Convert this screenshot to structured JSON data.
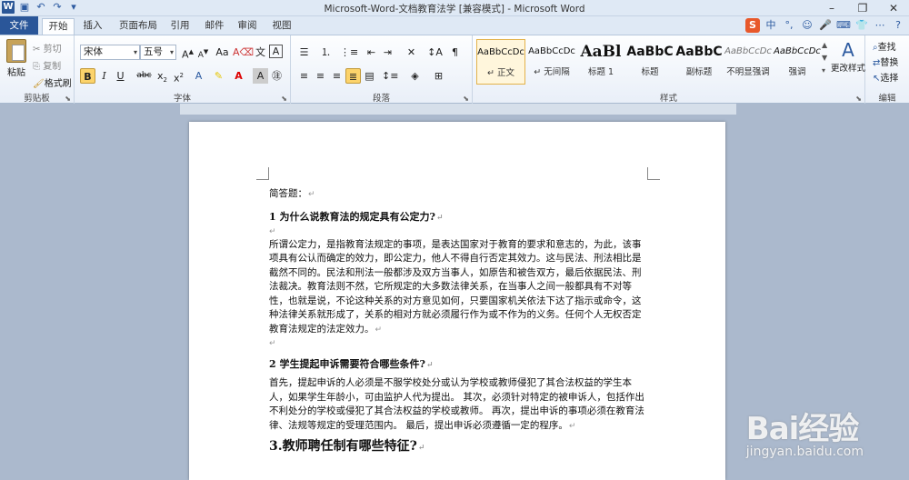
{
  "window": {
    "title": "Microsoft-Word-文档教育法学 [兼容模式] - Microsoft Word",
    "controls": [
      "minimize",
      "restore",
      "close"
    ]
  },
  "tabs": [
    {
      "label": "文件"
    },
    {
      "label": "开始"
    },
    {
      "label": "插入"
    },
    {
      "label": "页面布局"
    },
    {
      "label": "引用"
    },
    {
      "label": "邮件"
    },
    {
      "label": "审阅"
    },
    {
      "label": "视图"
    }
  ],
  "ime": {
    "badge": "S",
    "mode": "中"
  },
  "ribbon": {
    "clipboard": {
      "paste": "粘贴",
      "cut": "剪切",
      "copy": "复制",
      "format_painter": "格式刷",
      "group": "剪贴板"
    },
    "font": {
      "name": "宋体",
      "size": "五号",
      "group": "字体"
    },
    "paragraph": {
      "group": "段落"
    },
    "styles": {
      "group": "样式",
      "items": [
        {
          "sample": "AaBbCcDc",
          "name": "↵ 正文"
        },
        {
          "sample": "AaBbCcDc",
          "name": "↵ 无间隔"
        },
        {
          "sample": "AaBl",
          "name": "标题 1"
        },
        {
          "sample": "AaBbC",
          "name": "标题"
        },
        {
          "sample": "AaBbC",
          "name": "副标题"
        },
        {
          "sample": "AaBbCcDc",
          "name": "不明显强调"
        },
        {
          "sample": "AaBbCcDc",
          "name": "强调"
        }
      ],
      "change_styles": "更改样式"
    },
    "editing": {
      "find": "查找",
      "replace": "替换",
      "select": "选择",
      "group": "编辑"
    }
  },
  "document": {
    "intro": "简答题：",
    "q1_title": "1 为什么说教育法的规定具有公定力?",
    "q1_answer": "所谓公定力，是指教育法规定的事项，是表达国家对于教育的要求和意志的，为此，该事项具有公认而确定的效力，即公定力，他人不得自行否定其效力。这与民法、刑法相比是截然不同的。民法和刑法一般都涉及双方当事人，如原告和被告双方，最后依据民法、刑法裁决。教育法则不然，它所规定的大多数法律关系，在当事人之间一般都具有不对等性，也就是说，不论这种关系的对方意见如何，只要国家机关依法下达了指示或命令，这种法律关系就形成了，关系的相对方就必须履行作为或不作为的义务。任何个人无权否定教育法规定的法定效力。",
    "q2_title": "2 学生提起申诉需要符合哪些条件?",
    "q2_answer": "首先，提起申诉的人必须是不服学校处分或认为学校或教师侵犯了其合法权益的学生本人，如果学生年龄小，可由监护人代为提出。 其次，必须针对特定的被申诉人，包括作出不利处分的学校或侵犯了其合法权益的学校或教师。 再次，提出申诉的事项必须在教育法律、法规等规定的受理范围内。 最后，提出申诉必须遵循一定的程序。",
    "q3_title": "3.教师聘任制有哪些特征?",
    "paragraph_mark": "↵"
  },
  "watermark": {
    "logo": "Bai经验",
    "url": "jingyan.baidu.com"
  }
}
